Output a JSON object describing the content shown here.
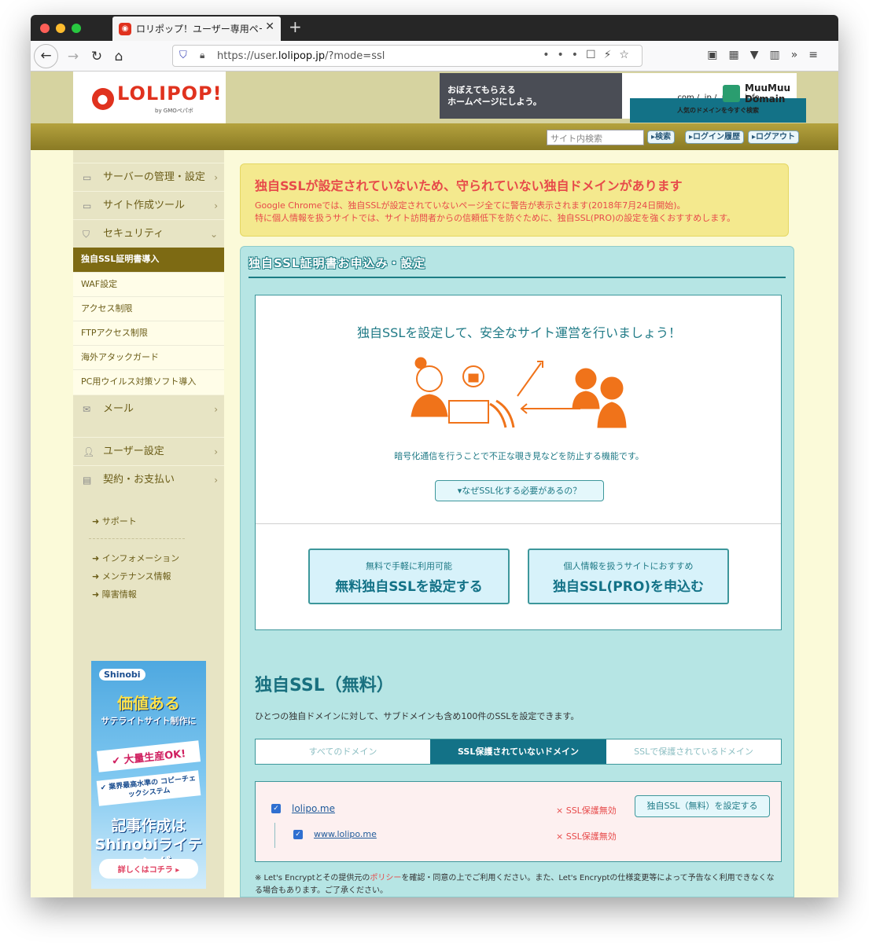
{
  "browser": {
    "tab_title": "ロリポップ！ユーザー専用ページ",
    "tab_close": "✕",
    "new_tab": "+",
    "url_prefix": "https://user.",
    "url_host": "lolipop.jp",
    "url_path": "/?mode=ssl"
  },
  "header": {
    "logo_text": "LOLIPOP!",
    "logo_sub": "by GMOペパボ",
    "banner1_line1": "おぼえてもらえる",
    "banner1_line2": "ホームページにしよう。",
    "banner2_tlds": ".com / .jp / .net / .info",
    "banner2_sub": "人気のドメインを今すぐ検索",
    "banner2_brand1": "MuuMuu",
    "banner2_brand2": "Domain"
  },
  "toolbar": {
    "search_placeholder": "サイト内検索",
    "search_btn": "▸検索",
    "history_btn": "▸ログイン履歴",
    "logout_btn": "▸ログアウト"
  },
  "sidebar": {
    "server": "サーバーの管理・設定",
    "site_tools": "サイト作成ツール",
    "security": "セキュリティ",
    "sub_ssl": "独自SSL証明書導入",
    "sub_waf": "WAF設定",
    "sub_access": "アクセス制限",
    "sub_ftp": "FTPアクセス制限",
    "sub_attack": "海外アタックガード",
    "sub_virus": "PC用ウイルス対策ソフト導入",
    "mail": "メール",
    "user": "ユーザー設定",
    "contract": "契約・お支払い",
    "support": "サポート",
    "info": "インフォメーション",
    "maint": "メンテナンス情報",
    "trouble": "障害情報"
  },
  "ad": {
    "brand": "Shinobi",
    "h1": "価値ある",
    "h2": "サテライトサイト制作に",
    "h3": "✔ 大量生産OK!",
    "h4": "✔ 業界最高水準の コピーチェックシステム",
    "h5": "記事作成は Shinobiライティング",
    "cta": "詳しくはコチラ ▸"
  },
  "alert": {
    "title": "独自SSLが設定されていないため、守られていない独自ドメインがあります",
    "line1": "Google Chromeでは、独自SSLが設定されていないページ全てに警告が表示されます(2018年7月24日開始)。",
    "line2": "特に個人情報を扱うサイトでは、サイト訪問者からの信頼低下を防ぐために、独自SSL(PRO)の設定を強くおすすめします。"
  },
  "main": {
    "panel_title": "独自SSL証明書お申込み・設定",
    "lead": "独自SSLを設定して、安全なサイト運営を行いましょう！",
    "desc": "暗号化通信を行うことで不正な覗き見などを防止する機能です。",
    "why": "▾なぜSSL化する必要があるの？",
    "cta1_small": "無料で手軽に利用可能",
    "cta1_big": "無料独自SSLを設定する",
    "cta2_small": "個人情報を扱うサイトにおすすめ",
    "cta2_big": "独自SSL(PRO)を申込む",
    "free_heading": "独自SSL（無料）",
    "free_desc": "ひとつの独自ドメインに対して、サブドメインも含め100件のSSLを設定できます。",
    "tab_all": "すべてのドメイン",
    "tab_unprotected": "SSL保護されていないドメイン",
    "tab_protected": "SSLで保護されているドメイン",
    "domain1": "lolipo.me",
    "domain2": "www.lolipo.me",
    "status1": "× SSL保護無効",
    "status2": "× SSL保護無効",
    "set_btn": "独自SSL（無料）を設定する",
    "note_a": "※ Let's Encryptとその提供元の",
    "note_policy": "ポリシー",
    "note_b": "を確認・同意の上でご利用ください。また、Let's Encryptの仕様変更等によって予告なく利用できなくなる場合もあります。ご了承ください。"
  },
  "colors": {
    "accent": "#137287",
    "alert_text": "#e74a4a",
    "illustration": "#f0731a"
  }
}
